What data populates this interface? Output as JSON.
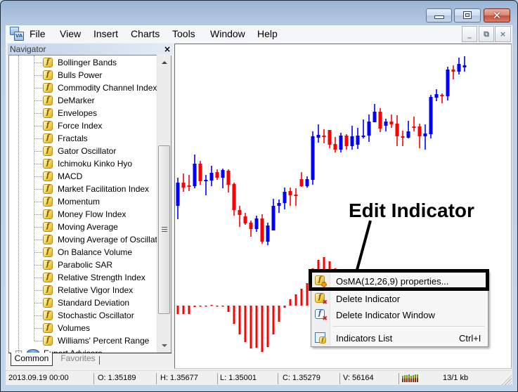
{
  "window": {
    "caption_buttons": {
      "minimize": "minimize-icon",
      "maximize": "maximize-icon",
      "close": "close-icon"
    },
    "app_icon": "metatrader-app-icon"
  },
  "menubar": {
    "items": [
      "File",
      "View",
      "Insert",
      "Charts",
      "Tools",
      "Window",
      "Help"
    ],
    "mdi_buttons": {
      "minimize": "_",
      "restore": "⧉",
      "close": "×"
    }
  },
  "navigator": {
    "title": "Navigator",
    "close_glyph": "×",
    "items": [
      "Bollinger Bands",
      "Bulls Power",
      "Commodity Channel Index",
      "DeMarker",
      "Envelopes",
      "Force Index",
      "Fractals",
      "Gator Oscillator",
      "Ichimoku Kinko Hyo",
      "MACD",
      "Market Facilitation Index",
      "Momentum",
      "Money Flow Index",
      "Moving Average",
      "Moving Average of Oscillator",
      "On Balance Volume",
      "Parabolic SAR",
      "Relative Strength Index",
      "Relative Vigor Index",
      "Standard Deviation",
      "Stochastic Oscillator",
      "Volumes",
      "Williams' Percent Range"
    ],
    "item_icon_glyph": "f",
    "partial_item": {
      "label": "Expert Advisors",
      "expander": "+"
    },
    "tabs": [
      "Common",
      "Favorites"
    ],
    "active_tab": "Common"
  },
  "annotation": {
    "text": "Edit Indicator"
  },
  "context_menu": {
    "items": [
      {
        "label": "OsMA(12,26,9) properties...",
        "icon": "indicator-properties-icon",
        "highlighted": true
      },
      {
        "label": "Delete Indicator",
        "icon": "delete-indicator-icon"
      },
      {
        "label": "Delete Indicator Window",
        "icon": "delete-indicator-window-icon"
      },
      {
        "label": "Indicators List",
        "icon": "indicators-list-icon",
        "shortcut": "Ctrl+I"
      }
    ]
  },
  "statusbar": {
    "datetime": "2013.09.19 00:00",
    "open": "O: 1.35189",
    "high": "H: 1.35677",
    "low": "L: 1.35001",
    "close": "C: 1.35279",
    "volume": "V: 56164",
    "traffic": "13/1 kb"
  },
  "chart_data": [
    {
      "type": "candlestick",
      "name": "price",
      "ylim": [
        1.27204,
        1.36199
      ],
      "bull_color": "#0000ff",
      "bear_color": "#ff0000",
      "ohlc": [
        [
          1.29138,
          1.30366,
          1.28555,
          1.30151
        ],
        [
          1.30151,
          1.3055,
          1.29752,
          1.29936
        ],
        [
          1.30028,
          1.30489,
          1.29783,
          1.29998
        ],
        [
          1.29998,
          1.31379,
          1.29905,
          1.3098
        ],
        [
          1.3098,
          1.31103,
          1.30059,
          1.30212
        ],
        [
          1.30212,
          1.30489,
          1.29598,
          1.30274
        ],
        [
          1.30243,
          1.30888,
          1.29998,
          1.30581
        ],
        [
          1.30612,
          1.30734,
          1.30274,
          1.30366
        ],
        [
          1.30366,
          1.30765,
          1.29905,
          1.30704
        ],
        [
          1.30673,
          1.30734,
          1.29721,
          1.30059
        ],
        [
          1.3009,
          1.30151,
          1.28708,
          1.28954
        ],
        [
          1.28954,
          1.29138,
          1.28217,
          1.28739
        ],
        [
          1.28677,
          1.28831,
          1.28309,
          1.2837
        ],
        [
          1.28401,
          1.28493,
          1.27787,
          1.28125
        ],
        [
          1.28125,
          1.28708,
          1.28002,
          1.28585
        ],
        [
          1.28585,
          1.2877,
          1.2748,
          1.27572
        ],
        [
          1.27572,
          1.28401,
          1.27419,
          1.28278
        ],
        [
          1.28063,
          1.29445,
          1.28063,
          1.29138
        ],
        [
          1.29138,
          1.29414,
          1.28831,
          1.29261
        ],
        [
          1.29261,
          1.29936,
          1.28984,
          1.29752
        ],
        [
          1.29783,
          1.29936,
          1.29138,
          1.29598
        ],
        [
          1.29629,
          1.29905,
          1.29138,
          1.29598
        ],
        [
          1.30305,
          1.30612,
          1.29967,
          1.29998
        ],
        [
          1.29998,
          1.30427,
          1.29936,
          1.30305
        ],
        [
          1.30274,
          1.32392,
          1.30059,
          1.32177
        ],
        [
          1.32116,
          1.32699,
          1.31901,
          1.32239
        ],
        [
          1.32208,
          1.32484,
          1.3187,
          1.32177
        ],
        [
          1.32454,
          1.32454,
          1.31655,
          1.31809
        ],
        [
          1.3184,
          1.32147,
          1.31471,
          1.31594
        ],
        [
          1.31594,
          1.32331,
          1.31471,
          1.32208
        ],
        [
          1.32208,
          1.32269,
          1.31594,
          1.31747
        ],
        [
          1.31747,
          1.32638,
          1.31594,
          1.32177
        ],
        [
          1.31809,
          1.32546,
          1.31625,
          1.32208
        ],
        [
          1.32177,
          1.32914,
          1.32085,
          1.32208
        ],
        [
          1.32208,
          1.33129,
          1.31932,
          1.32822
        ],
        [
          1.32791,
          1.33589,
          1.32791,
          1.33252
        ],
        [
          1.33252,
          1.33405,
          1.32361,
          1.32515
        ],
        [
          1.32638,
          1.32945,
          1.32392,
          1.32822
        ],
        [
          1.32822,
          1.33129,
          1.32546,
          1.32699
        ],
        [
          1.3273,
          1.33098,
          1.31747,
          1.32177
        ],
        [
          1.32177,
          1.32423,
          1.31747,
          1.32116
        ],
        [
          1.32116,
          1.32853,
          1.32085,
          1.32392
        ],
        [
          1.32607,
          1.33037,
          1.32392,
          1.32576
        ],
        [
          1.32607,
          1.3273,
          1.31655,
          1.32177
        ],
        [
          1.32177,
          1.32699,
          1.31594,
          1.323
        ],
        [
          1.32269,
          1.33989,
          1.32085,
          1.33896
        ],
        [
          1.33866,
          1.34234,
          1.33712,
          1.34019
        ],
        [
          1.33989,
          1.3405,
          1.3362,
          1.33927
        ],
        [
          1.33927,
          1.35217,
          1.33743,
          1.35094
        ],
        [
          1.35094,
          1.35278,
          1.34664,
          1.35002
        ],
        [
          1.35002,
          1.35616,
          1.34879,
          1.35339
        ],
        [
          1.35189,
          1.35677,
          1.35001,
          1.35279
        ]
      ]
    },
    {
      "type": "bar",
      "name": "OsMA(12,26,9)",
      "units": "relative",
      "ylim": [
        -89,
        77
      ],
      "color": "#ff0000",
      "values": [
        -12,
        -12,
        -12,
        -2,
        -1,
        -1,
        1,
        -1,
        -1,
        -9,
        -26,
        -41,
        -52,
        -61,
        -60,
        -66,
        -59,
        -41,
        -23,
        -3,
        9,
        16,
        24,
        32,
        53,
        65,
        69,
        63,
        53
      ]
    }
  ]
}
